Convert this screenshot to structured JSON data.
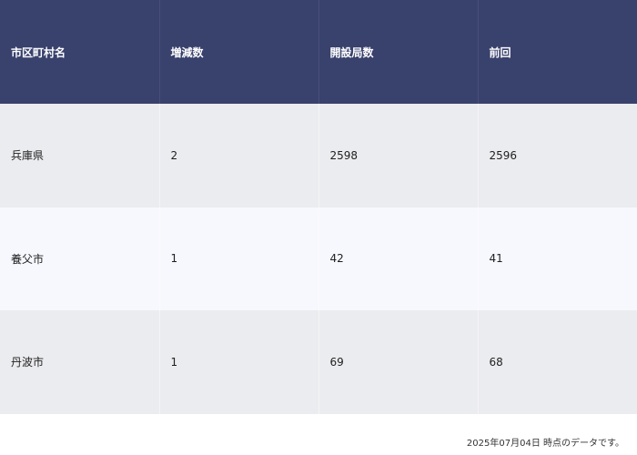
{
  "table": {
    "headers": [
      "市区町村名",
      "増減数",
      "開設局数",
      "前回"
    ],
    "rows": [
      [
        "兵庫県",
        "2",
        "2598",
        "2596"
      ],
      [
        "養父市",
        "1",
        "42",
        "41"
      ],
      [
        "丹波市",
        "1",
        "69",
        "68"
      ]
    ]
  },
  "footer": {
    "note": "2025年07月04日 時点のデータです。"
  }
}
